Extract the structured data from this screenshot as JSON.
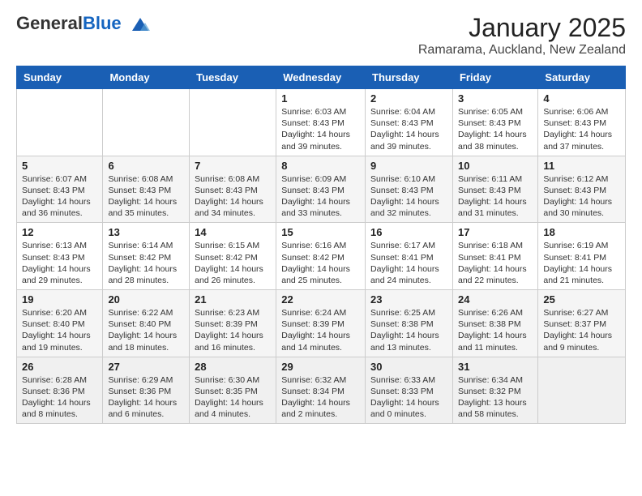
{
  "header": {
    "logo_general": "General",
    "logo_blue": "Blue",
    "month_title": "January 2025",
    "location": "Ramarama, Auckland, New Zealand"
  },
  "weekdays": [
    "Sunday",
    "Monday",
    "Tuesday",
    "Wednesday",
    "Thursday",
    "Friday",
    "Saturday"
  ],
  "weeks": [
    [
      {
        "day": "",
        "info": ""
      },
      {
        "day": "",
        "info": ""
      },
      {
        "day": "",
        "info": ""
      },
      {
        "day": "1",
        "info": "Sunrise: 6:03 AM\nSunset: 8:43 PM\nDaylight: 14 hours\nand 39 minutes."
      },
      {
        "day": "2",
        "info": "Sunrise: 6:04 AM\nSunset: 8:43 PM\nDaylight: 14 hours\nand 39 minutes."
      },
      {
        "day": "3",
        "info": "Sunrise: 6:05 AM\nSunset: 8:43 PM\nDaylight: 14 hours\nand 38 minutes."
      },
      {
        "day": "4",
        "info": "Sunrise: 6:06 AM\nSunset: 8:43 PM\nDaylight: 14 hours\nand 37 minutes."
      }
    ],
    [
      {
        "day": "5",
        "info": "Sunrise: 6:07 AM\nSunset: 8:43 PM\nDaylight: 14 hours\nand 36 minutes."
      },
      {
        "day": "6",
        "info": "Sunrise: 6:08 AM\nSunset: 8:43 PM\nDaylight: 14 hours\nand 35 minutes."
      },
      {
        "day": "7",
        "info": "Sunrise: 6:08 AM\nSunset: 8:43 PM\nDaylight: 14 hours\nand 34 minutes."
      },
      {
        "day": "8",
        "info": "Sunrise: 6:09 AM\nSunset: 8:43 PM\nDaylight: 14 hours\nand 33 minutes."
      },
      {
        "day": "9",
        "info": "Sunrise: 6:10 AM\nSunset: 8:43 PM\nDaylight: 14 hours\nand 32 minutes."
      },
      {
        "day": "10",
        "info": "Sunrise: 6:11 AM\nSunset: 8:43 PM\nDaylight: 14 hours\nand 31 minutes."
      },
      {
        "day": "11",
        "info": "Sunrise: 6:12 AM\nSunset: 8:43 PM\nDaylight: 14 hours\nand 30 minutes."
      }
    ],
    [
      {
        "day": "12",
        "info": "Sunrise: 6:13 AM\nSunset: 8:43 PM\nDaylight: 14 hours\nand 29 minutes."
      },
      {
        "day": "13",
        "info": "Sunrise: 6:14 AM\nSunset: 8:42 PM\nDaylight: 14 hours\nand 28 minutes."
      },
      {
        "day": "14",
        "info": "Sunrise: 6:15 AM\nSunset: 8:42 PM\nDaylight: 14 hours\nand 26 minutes."
      },
      {
        "day": "15",
        "info": "Sunrise: 6:16 AM\nSunset: 8:42 PM\nDaylight: 14 hours\nand 25 minutes."
      },
      {
        "day": "16",
        "info": "Sunrise: 6:17 AM\nSunset: 8:41 PM\nDaylight: 14 hours\nand 24 minutes."
      },
      {
        "day": "17",
        "info": "Sunrise: 6:18 AM\nSunset: 8:41 PM\nDaylight: 14 hours\nand 22 minutes."
      },
      {
        "day": "18",
        "info": "Sunrise: 6:19 AM\nSunset: 8:41 PM\nDaylight: 14 hours\nand 21 minutes."
      }
    ],
    [
      {
        "day": "19",
        "info": "Sunrise: 6:20 AM\nSunset: 8:40 PM\nDaylight: 14 hours\nand 19 minutes."
      },
      {
        "day": "20",
        "info": "Sunrise: 6:22 AM\nSunset: 8:40 PM\nDaylight: 14 hours\nand 18 minutes."
      },
      {
        "day": "21",
        "info": "Sunrise: 6:23 AM\nSunset: 8:39 PM\nDaylight: 14 hours\nand 16 minutes."
      },
      {
        "day": "22",
        "info": "Sunrise: 6:24 AM\nSunset: 8:39 PM\nDaylight: 14 hours\nand 14 minutes."
      },
      {
        "day": "23",
        "info": "Sunrise: 6:25 AM\nSunset: 8:38 PM\nDaylight: 14 hours\nand 13 minutes."
      },
      {
        "day": "24",
        "info": "Sunrise: 6:26 AM\nSunset: 8:38 PM\nDaylight: 14 hours\nand 11 minutes."
      },
      {
        "day": "25",
        "info": "Sunrise: 6:27 AM\nSunset: 8:37 PM\nDaylight: 14 hours\nand 9 minutes."
      }
    ],
    [
      {
        "day": "26",
        "info": "Sunrise: 6:28 AM\nSunset: 8:36 PM\nDaylight: 14 hours\nand 8 minutes."
      },
      {
        "day": "27",
        "info": "Sunrise: 6:29 AM\nSunset: 8:36 PM\nDaylight: 14 hours\nand 6 minutes."
      },
      {
        "day": "28",
        "info": "Sunrise: 6:30 AM\nSunset: 8:35 PM\nDaylight: 14 hours\nand 4 minutes."
      },
      {
        "day": "29",
        "info": "Sunrise: 6:32 AM\nSunset: 8:34 PM\nDaylight: 14 hours\nand 2 minutes."
      },
      {
        "day": "30",
        "info": "Sunrise: 6:33 AM\nSunset: 8:33 PM\nDaylight: 14 hours\nand 0 minutes."
      },
      {
        "day": "31",
        "info": "Sunrise: 6:34 AM\nSunset: 8:32 PM\nDaylight: 13 hours\nand 58 minutes."
      },
      {
        "day": "",
        "info": ""
      }
    ]
  ]
}
